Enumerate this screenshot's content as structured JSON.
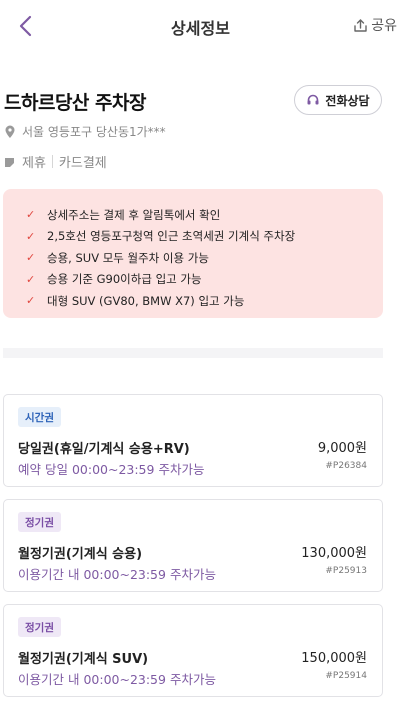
{
  "header": {
    "title": "상세정보",
    "share_label": "공유"
  },
  "lot": {
    "name": "드하르당산 주차장",
    "call_label": "전화상담",
    "address": "서울 영등포구 당산동1가***",
    "tags": [
      "제휴",
      "카드결제"
    ]
  },
  "notice": {
    "items": [
      "상세주소는 결제 후 알림톡에서 확인",
      "2,5호선 영등포구청역 인근 초역세권 기계식 주차장",
      "승용, SUV 모두 월주차 이용 가능",
      "승용 기준 G90이하급 입고 가능",
      "대형 SUV (GV80, BMW X7) 입고 가능"
    ]
  },
  "tickets": [
    {
      "badge": "시간권",
      "name": "당일권(휴일/기계식 승용+RV)",
      "price": "9,000원",
      "desc": "예약 당일 00:00~23:59 주차가능",
      "code": "#P26384"
    },
    {
      "badge": "정기권",
      "name": "월정기권(기계식 승용)",
      "price": "130,000원",
      "desc": "이용기간 내 00:00~23:59 주차가능",
      "code": "#P25913"
    },
    {
      "badge": "정기권",
      "name": "월정기권(기계식 SUV)",
      "price": "150,000원",
      "desc": "이용기간 내 00:00~23:59 주차가능",
      "code": "#P25914"
    }
  ],
  "colors": {
    "accent": "#7e5aa3",
    "notice_bg": "#fde3e2",
    "check": "#e0473f"
  }
}
